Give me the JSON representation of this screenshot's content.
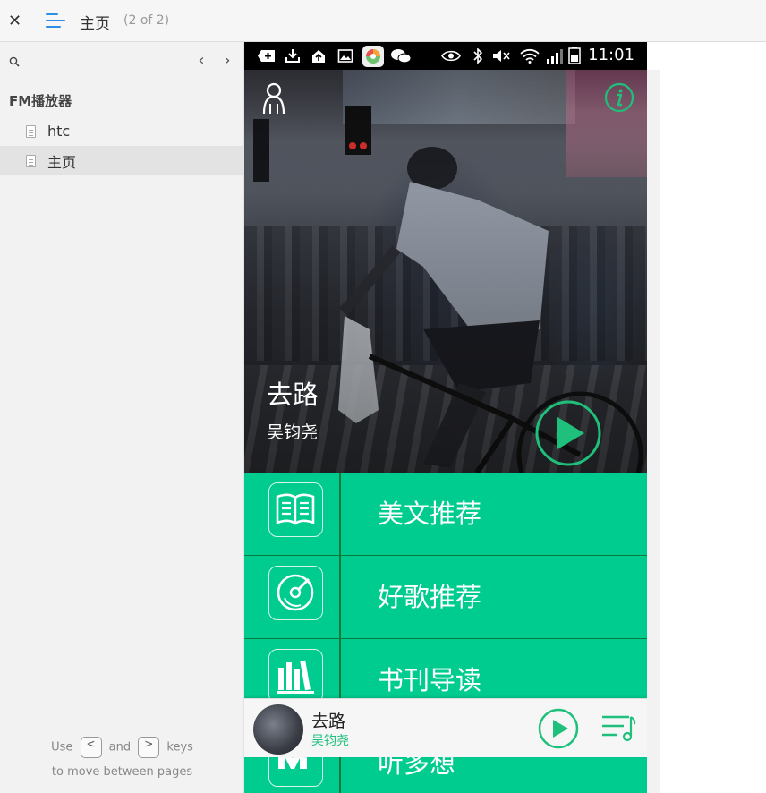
{
  "toolbar": {
    "close_glyph": "✕",
    "page_title": "主页",
    "page_count": "(2 of 2)"
  },
  "sidebar": {
    "prev_glyph": "‹",
    "next_glyph": "›",
    "project": "FM播放器",
    "items": [
      {
        "label": "htc",
        "selected": false
      },
      {
        "label": "主页",
        "selected": true
      }
    ],
    "hint": {
      "use": "Use",
      "key_prev": "<",
      "and": "and",
      "key_next": ">",
      "keys": "keys",
      "line2": "to move between pages"
    }
  },
  "phone": {
    "status_time": "11:01",
    "hero": {
      "title": "去路",
      "artist": "吴钧尧"
    },
    "menu": [
      {
        "label": "美文推荐",
        "icon": "book-icon"
      },
      {
        "label": "好歌推荐",
        "icon": "disc-icon"
      },
      {
        "label": "书刊导读",
        "icon": "bookshelf-icon"
      },
      {
        "label": "听多想",
        "icon": "mp-icon"
      }
    ],
    "mini_player": {
      "title": "去路",
      "artist": "吴钧尧"
    }
  },
  "colors": {
    "accent": "#00cc8f",
    "divider": "#0a7a3c",
    "play_green": "#1fc07b",
    "menu_blue": "#2b8fe8"
  }
}
